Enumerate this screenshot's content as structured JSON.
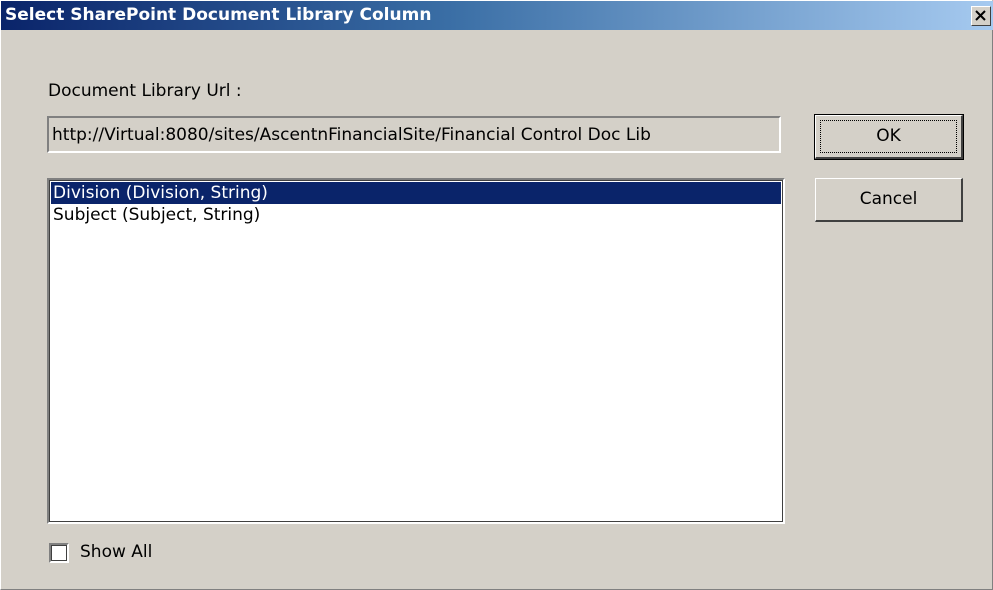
{
  "window": {
    "title": "Select SharePoint Document Library Column"
  },
  "form": {
    "url_label": "Document Library Url :",
    "url_value": "http://Virtual:8080/sites/AscentnFinancialSite/Financial Control Doc Lib",
    "columns": [
      {
        "label": "Division (Division, String)",
        "selected": true
      },
      {
        "label": "Subject (Subject, String)",
        "selected": false
      }
    ],
    "show_all_label": "Show All",
    "show_all_checked": false
  },
  "buttons": {
    "ok_label": "OK",
    "cancel_label": "Cancel"
  },
  "colors": {
    "titlebar_start": "#0a246a",
    "titlebar_end": "#a6caf0",
    "selection": "#0a246a",
    "dialog_bg": "#d4d0c8"
  },
  "icons": {
    "close": "close-icon"
  }
}
